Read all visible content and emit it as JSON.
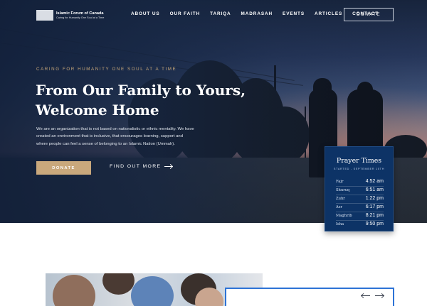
{
  "header": {
    "logo_title": "Islamic Forum of Canada",
    "logo_subtitle": "Caring for Humanity One Soul at a Time",
    "nav": [
      "ABOUT US",
      "OUR FAITH",
      "TARIQA",
      "MADRASAH",
      "EVENTS",
      "ARTICLES",
      "CONTACT"
    ],
    "donate_label": "DONATE"
  },
  "hero": {
    "tagline": "CARING FOR HUMANITY ONE SOUL AT A TIME",
    "headline_line1": "From Our Family to Yours,",
    "headline_line2": "Welcome Home",
    "description": "We are an organization that is not based on nationalistic or ethnic mentality. We have created an environment that is inclusive, that encourages learning, support and where people can feel a sense of belonging to an Islamic Nation (Ummah).",
    "donate_label": "DONATE",
    "find_more_label": "FIND OUT MORE"
  },
  "prayer_times": {
    "title": "Prayer Times",
    "subtitle": "STARTED - SEPTEMBER 15TH",
    "rows": [
      {
        "name": "Fajr",
        "time": "4:52 am"
      },
      {
        "name": "Shuruq",
        "time": "6:51 am"
      },
      {
        "name": "Zuhr",
        "time": "1:22 pm"
      },
      {
        "name": "Asr",
        "time": "6:17 pm"
      },
      {
        "name": "Maghrib",
        "time": "8:21 pm"
      },
      {
        "name": "Isha",
        "time": "9:50 pm"
      }
    ]
  },
  "colors": {
    "accent_gold": "#c9a87c",
    "prayer_blue": "#0d3366",
    "card_border": "#2d73d6"
  }
}
